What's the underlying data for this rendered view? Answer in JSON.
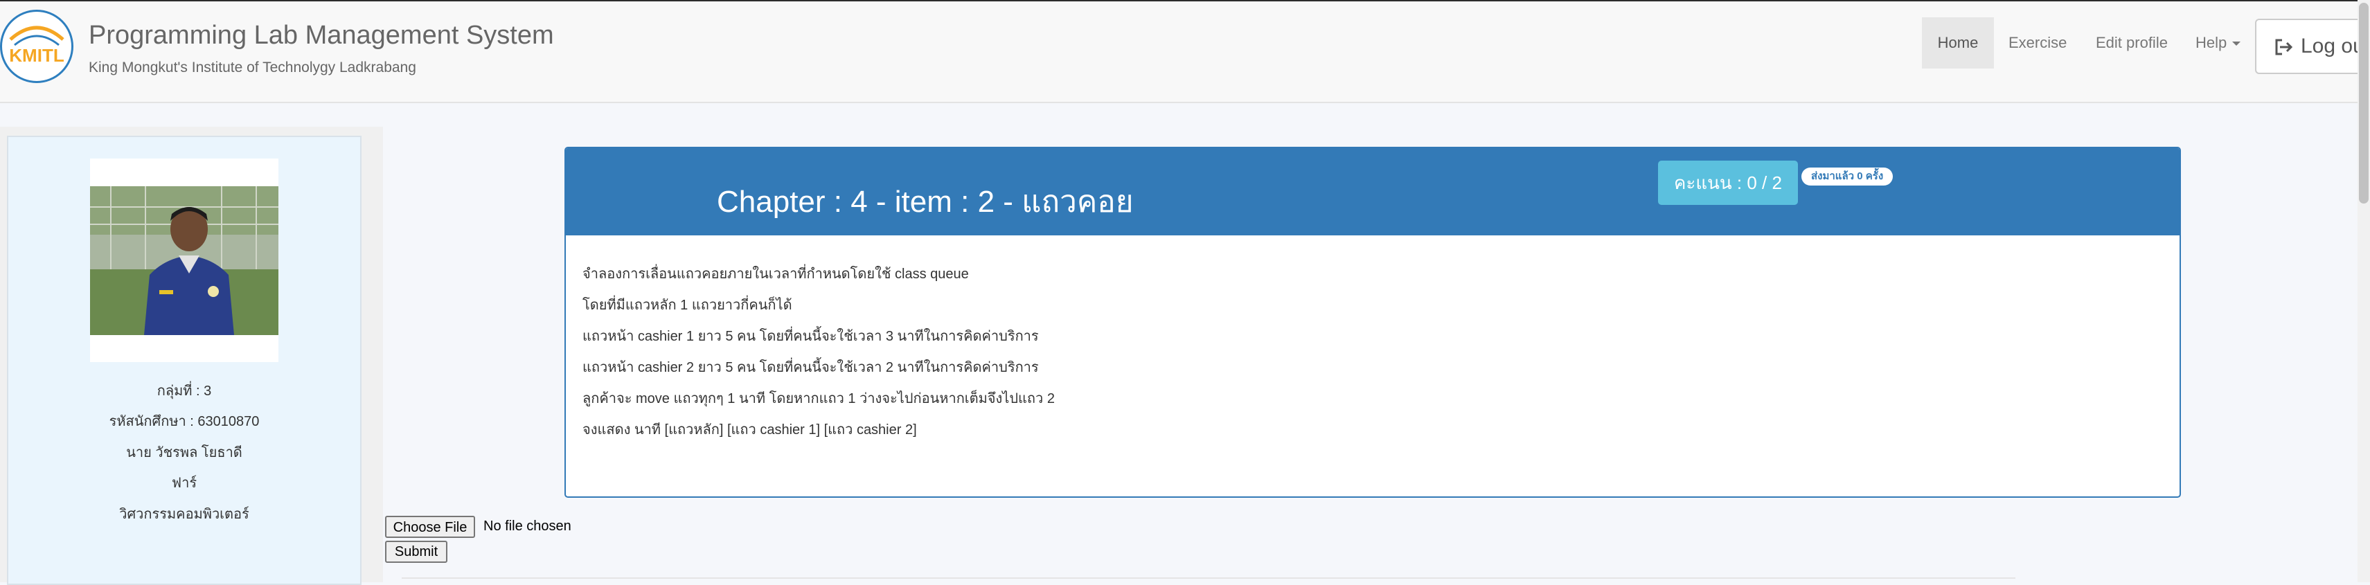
{
  "header": {
    "logo_text": "KMITL",
    "app_title": "Programming Lab Management System",
    "subtitle": "King Mongkut's Institute of Technolygy Ladkrabang",
    "nav": [
      "Home",
      "Exercise",
      "Edit profile",
      "Help"
    ],
    "logout_label": "Log out"
  },
  "profile": {
    "group": "กลุ่มที่ : 3",
    "student_id": "รหัสนักศึกษา : 63010870",
    "name": "นาย วัชรพล โยธาดี",
    "nickname": "ฟาร์",
    "faculty": "วิศวกรรมคอมพิวเตอร์"
  },
  "exercise": {
    "title": "Chapter : 4 - item : 2 - แถวคอย",
    "score": "คะแนน : 0 / 2",
    "submissions": "ส่งมาแล้ว 0 ครั้ง",
    "description": [
      "จำลองการเลื่อนแถวคอยภายในเวลาที่กำหนดโดยใช้ class queue",
      "โดยที่มีแถวหลัก 1 แถวยาวกี่คนก็ได้",
      "แถวหน้า cashier 1 ยาว 5 คน โดยที่คนนี้จะใช้เวลา 3 นาทีในการคิดค่าบริการ",
      "แถวหน้า cashier 2 ยาว 5 คน โดยที่คนนี้จะใช้เวลา 2 นาทีในการคิดค่าบริการ",
      "ลูกค้าจะ move แถวทุกๆ 1 นาที โดยหากแถว 1 ว่างจะไปก่อนหากเต็มจึงไปแถว 2",
      "จงแสดง นาที [แถวหลัก] [แถว cashier 1] [แถว cashier 2]"
    ]
  },
  "upload": {
    "choose_label": "Choose File",
    "status": "No file chosen",
    "submit_label": "Submit"
  },
  "colors": {
    "primary": "#337ab7",
    "info": "#5bc0de",
    "sidebar": "#eaf5fd"
  }
}
